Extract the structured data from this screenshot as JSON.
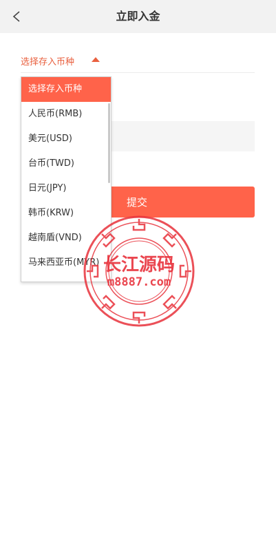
{
  "header": {
    "title": "立即入金",
    "back_icon": "chevron-left-icon"
  },
  "form": {
    "currency_label": "选择存入币种",
    "caret_icon": "caret-up-icon",
    "amount_value": "",
    "submit_label": "提交"
  },
  "dropdown": {
    "options": [
      "选择存入币种",
      "人民币(RMB)",
      "美元(USD)",
      "台币(TWD)",
      "日元(JPY)",
      "韩币(KRW)",
      "越南盾(VND)",
      "马来西亚币(MYR)"
    ],
    "selected_index": 0
  },
  "watermark": {
    "line1": "长江源码",
    "line2": "m8887.com"
  },
  "colors": {
    "accent": "#ff634a",
    "accent_text": "#e9603f",
    "header_bg": "#f2f2f2",
    "watermark": "#e8323c"
  }
}
